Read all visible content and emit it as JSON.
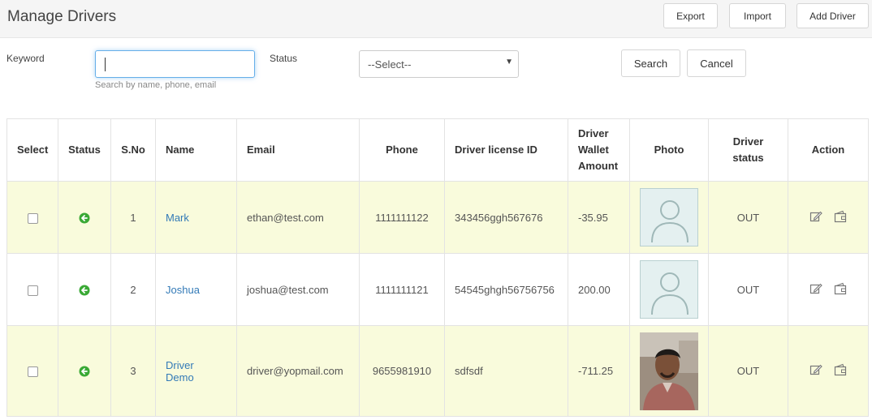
{
  "header": {
    "title": "Manage Drivers",
    "buttons": {
      "export": "Export",
      "import": "Import",
      "add_driver": "Add Driver"
    }
  },
  "filters": {
    "keyword_label": "Keyword",
    "keyword_value": "",
    "keyword_hint": "Search by name, phone, email",
    "status_label": "Status",
    "status_selected": "--Select--",
    "search_label": "Search",
    "cancel_label": "Cancel"
  },
  "table": {
    "headers": {
      "select": "Select",
      "status": "Status",
      "sno": "S.No",
      "name": "Name",
      "email": "Email",
      "phone": "Phone",
      "license": "Driver license ID",
      "wallet_1": "Driver",
      "wallet_2": "Wallet",
      "wallet_3": "Amount",
      "photo": "Photo",
      "dstatus_1": "Driver",
      "dstatus_2": "status",
      "action": "Action"
    },
    "rows": [
      {
        "sno": "1",
        "name_1": "Mark",
        "name_2": "",
        "email": "ethan@test.com",
        "phone": "1111111122",
        "license": "343456ggh567676",
        "wallet": "-35.95",
        "photo": "placeholder-avatar",
        "driver_status": "OUT"
      },
      {
        "sno": "2",
        "name_1": "Joshua",
        "name_2": "",
        "email": "joshua@test.com",
        "phone": "1111111121",
        "license": "54545ghgh56756756",
        "wallet": "200.00",
        "photo": "placeholder-avatar",
        "driver_status": "OUT"
      },
      {
        "sno": "3",
        "name_1": "Driver",
        "name_2": "Demo",
        "email": "driver@yopmail.com",
        "phone": "9655981910",
        "license": "sdfsdf",
        "wallet": "-711.25",
        "photo": "driver-photo",
        "driver_status": "OUT"
      }
    ]
  },
  "icons": {
    "status": "green-refresh-icon",
    "edit": "edit-icon",
    "wallet": "wallet-icon",
    "select_arrow": "caret-down-icon"
  },
  "colors": {
    "link": "#337ab7",
    "row_highlight": "#f9fbdc",
    "status_green": "#3aa935",
    "focus_border": "#66afe9"
  }
}
